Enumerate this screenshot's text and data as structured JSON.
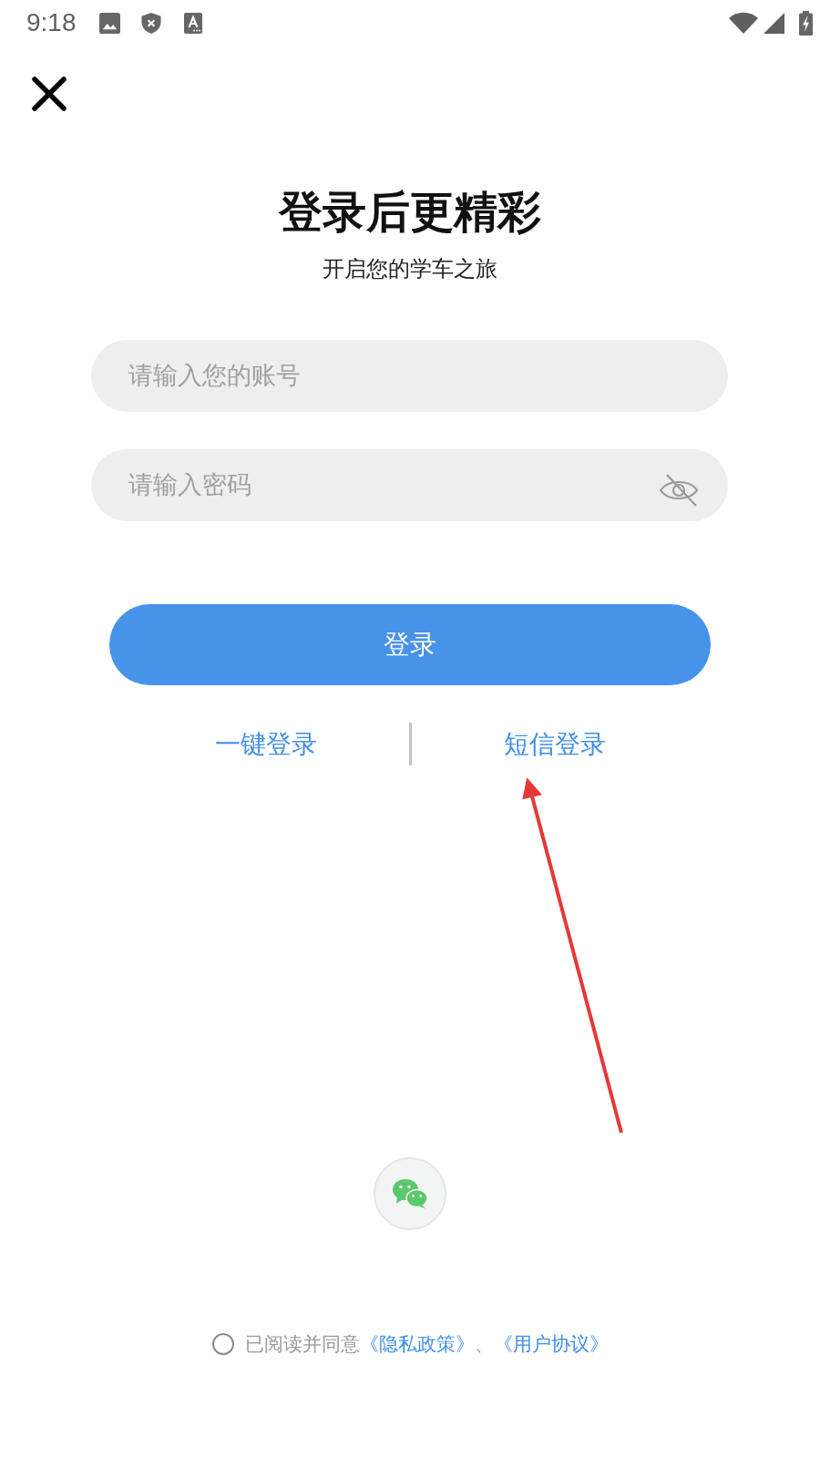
{
  "status_bar": {
    "time": "9:18"
  },
  "header": {
    "title": "登录后更精彩",
    "subtitle": "开启您的学车之旅"
  },
  "account_field": {
    "placeholder": "请输入您的账号"
  },
  "password_field": {
    "placeholder": "请输入密码",
    "password_visible": false
  },
  "login_button": {
    "label": "登录"
  },
  "alt_logins": [
    {
      "label": "一键登录"
    },
    {
      "label": "短信登录"
    }
  ],
  "social_logins": [
    {
      "kind": "wechat"
    }
  ],
  "agreement": {
    "checked": false,
    "parts": [
      {
        "kind": "text",
        "text": "已阅读并同意"
      },
      {
        "kind": "link",
        "text": "《隐私政策》"
      },
      {
        "kind": "text",
        "text": "、"
      },
      {
        "kind": "link",
        "text": "《用户协议》"
      }
    ]
  },
  "annotations": [
    {
      "kind": "arrow"
    }
  ]
}
